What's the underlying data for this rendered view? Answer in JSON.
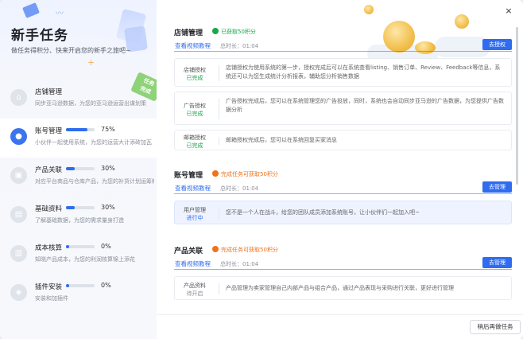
{
  "sidebar": {
    "title": "新手任务",
    "subtitle": "做任务得积分、快来开启您的新手之旅吧~",
    "stamp": "任务\n完成",
    "tasks": [
      {
        "name": "店铺管理",
        "desc": "同步亚马逊数据，为您的亚马逊运营出谋划策",
        "icon": "store-icon",
        "percent_text": "",
        "progress": null
      },
      {
        "name": "账号管理",
        "desc": "小伙伴一起使用系统，为您的运营大计添砖加瓦",
        "icon": "users-icon",
        "percent_text": "75%",
        "progress": 0.75
      },
      {
        "name": "产品关联",
        "desc": "对应平台商品与仓库产品，为您的补货计划运筹帷幄",
        "icon": "box-icon",
        "percent_text": "30%",
        "progress": 0.3
      },
      {
        "name": "基础资料",
        "desc": "了解基础数据，为您的需求量身打造",
        "icon": "document-icon",
        "percent_text": "30%",
        "progress": 0.3
      },
      {
        "name": "成本核算",
        "desc": "知晓产品成本，为您的利润核算锦上添花",
        "icon": "building-icon",
        "percent_text": "0%",
        "progress": 0
      },
      {
        "name": "插件安装",
        "desc": "安装和加插件",
        "icon": "plugin-icon",
        "percent_text": "0%",
        "progress": 0
      }
    ]
  },
  "main": {
    "close_label": "×",
    "sections": [
      {
        "title": "店铺管理",
        "badge": "已获取50积分",
        "badge_type": "ok",
        "video_link": "查看视频教程",
        "duration": "总时长：01:04",
        "button": "去授权",
        "rows": [
          {
            "name": "店铺授权",
            "status": "已完成",
            "status_type": "done",
            "desc": "店铺授权为使用系统的第一步，授权完成后可以在系统查看listing、销售订单、Review、Feedback等信息，系统还可以为您生成统计分析报表，辅助您分析销售数据"
          },
          {
            "name": "广告授权",
            "status": "已完成",
            "status_type": "done",
            "desc": "广告授权完成后，您可以在系统管理您的广告投放，同时，系统也会自动同步亚马逊的广告数据，为您提供广告数据分析"
          },
          {
            "name": "邮箱授权",
            "status": "已完成",
            "status_type": "done",
            "desc": "邮箱授权完成后，您可以在系统回复买家消息"
          }
        ]
      },
      {
        "title": "账号管理",
        "badge": "完成任务可获取50积分",
        "badge_type": "warn",
        "video_link": "查看视频教程",
        "duration": "总时长：01:04",
        "button": "去管理",
        "rows": [
          {
            "name": "用户管理",
            "status": "进行中",
            "status_type": "doing",
            "desc": "您不是一个人在战斗，给您的团队成员添加系统账号，让小伙伴们一起加入吧~"
          }
        ]
      },
      {
        "title": "产品关联",
        "badge": "完成任务可获取50积分",
        "badge_type": "warn",
        "video_link": "查看视频教程",
        "duration": "总时长：01:04",
        "button": "去管理",
        "rows": [
          {
            "name": "产品资料",
            "status": "待开启",
            "status_type": "wait",
            "desc": "产品管理为卖家管理自己内部产品与组合产品，通过产品表现与采购进行关联，更好进行管理"
          }
        ]
      }
    ]
  },
  "footer": {
    "later_button": "稍后再做任务"
  },
  "colors": {
    "primary": "#2f6cef",
    "success": "#19a84a",
    "warning": "#f0721a"
  }
}
